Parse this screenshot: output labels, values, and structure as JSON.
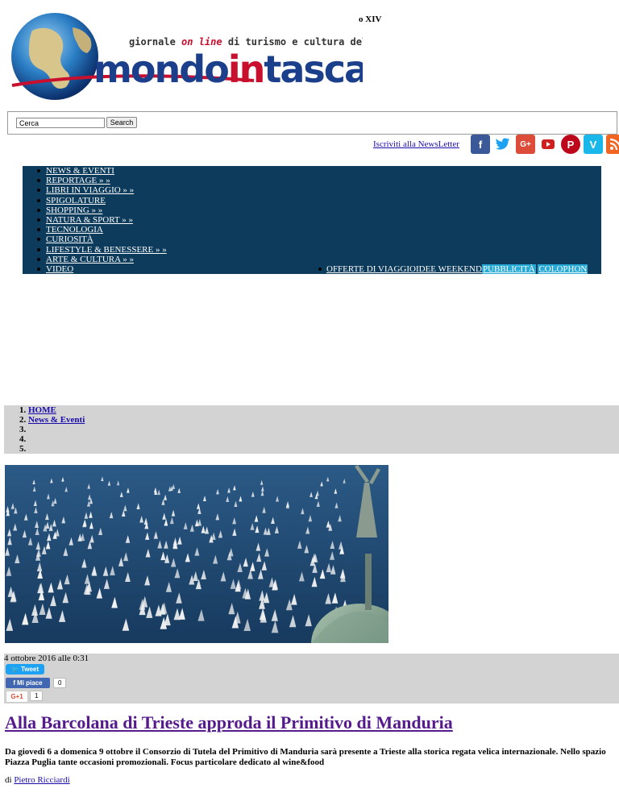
{
  "header": {
    "issue": "o XIV",
    "tagline_parts": [
      "giornale ",
      "on line",
      " di turismo e cultura del viaggiare"
    ],
    "logo_parts": [
      "mondo",
      "in",
      "tasca"
    ]
  },
  "search": {
    "placeholder": "Cerca",
    "value": "Cerca",
    "button": "Search"
  },
  "newsletter": "Iscriviti alla NewsLetter",
  "social": [
    {
      "icon": "facebook-icon",
      "glyph": "f",
      "color": "#3b5998"
    },
    {
      "icon": "twitter-icon",
      "glyph": "🐦",
      "color": "#1da1f2"
    },
    {
      "icon": "google-plus-icon",
      "glyph": "G+",
      "color": "#dd4b39"
    },
    {
      "icon": "youtube-icon",
      "glyph": "▶",
      "color": "#cd201f"
    },
    {
      "icon": "pinterest-icon",
      "glyph": "P",
      "color": "#bd081c"
    },
    {
      "icon": "vimeo-icon",
      "glyph": "V",
      "color": "#1ab7ea"
    },
    {
      "icon": "rss-icon",
      "glyph": "◔",
      "color": "#f26522"
    }
  ],
  "nav": {
    "items": [
      "NEWS & EVENTI",
      "REPORTAGE » »",
      "LIBRI IN VIAGGIO » »",
      "SPIGOLATURE",
      "SHOPPING » »",
      "NATURA & SPORT » »",
      "TECNOLOGIA",
      "CURIOSITÀ",
      "LIFESTYLE & BENESSERE » »",
      "ARTE & CULTURA » »",
      "VIDEO"
    ],
    "offerte": "OFFERTE DI VIAGGIO",
    "idee": "IDEE WEEKEND",
    "pubblicita": "PUBBLICITÀ",
    "colophon": "COLOPHON"
  },
  "breadcrumb": [
    "HOME",
    "News & Eventi",
    "",
    "",
    ""
  ],
  "article": {
    "date": "4 ottobre 2016 alle 0:31",
    "tweet": "Tweet",
    "like": "Mi piace",
    "like_count": "0",
    "gplus": "G+1",
    "gplus_count": "1",
    "title": "Alla Barcolana di Trieste approda il Primitivo di Manduria",
    "lead": "Da giovedì 6 a domenica 9 ottobre il Consorzio di Tutela del Primitivo di Manduria sarà presente a Trieste alla storica regata velica internazionale. Nello spazio Piazza Puglia tante occasioni promozionali. Focus particolare dedicato al wine&food",
    "author_prefix": "di ",
    "author": "Pietro Ricciardi"
  },
  "colors": {
    "nav_bg": "#0d3b5c",
    "breadcrumb_bg": "#d3d3d3",
    "logo_red": "#c8102e",
    "logo_blue": "#1b3f8b"
  }
}
